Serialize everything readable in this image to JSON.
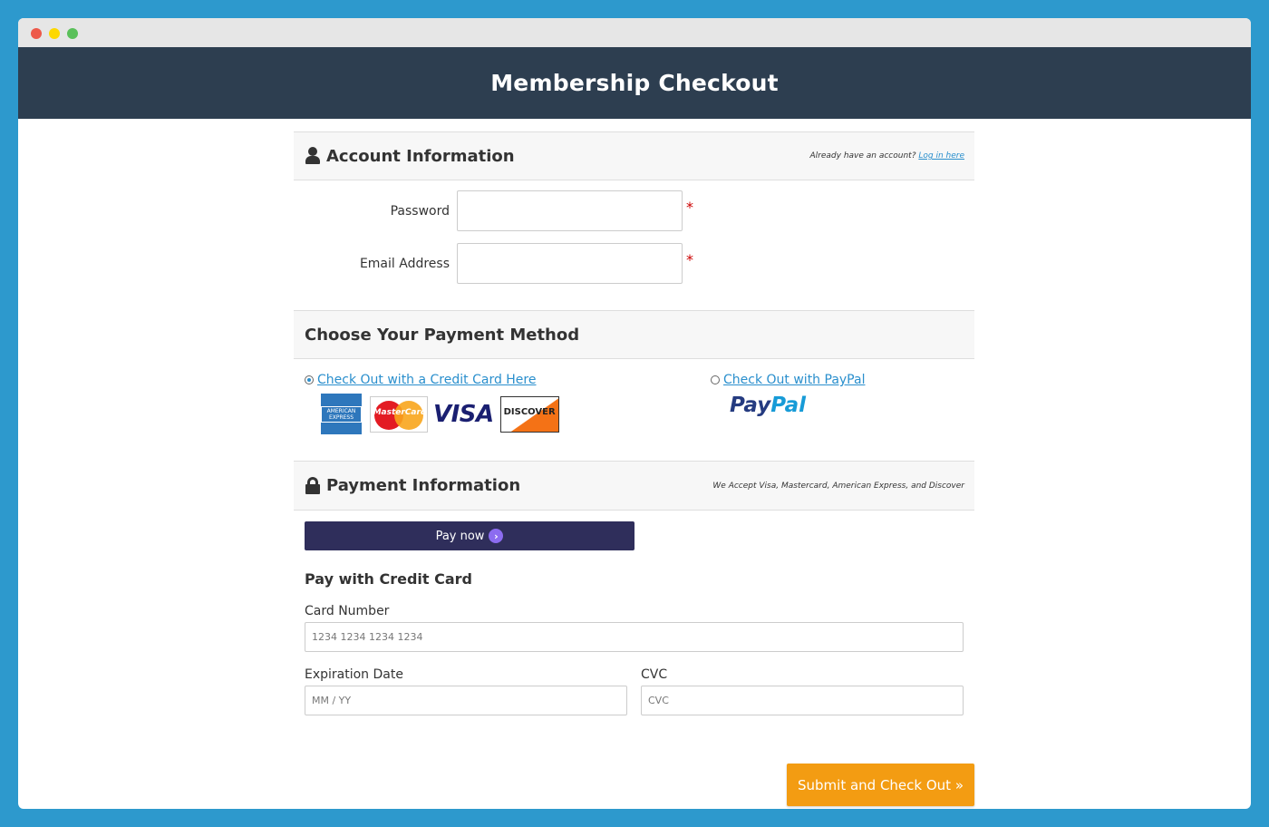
{
  "page": {
    "title": "Membership Checkout"
  },
  "account": {
    "heading": "Account Information",
    "note_prefix": "Already have an account?",
    "login_link": "Log in here",
    "fields": [
      {
        "label": "Password",
        "value": ""
      },
      {
        "label": "Email Address",
        "value": ""
      }
    ],
    "required_mark": "*"
  },
  "payment_method": {
    "heading": "Choose Your Payment Method",
    "credit_card": {
      "label": "Check Out with a Credit Card Here",
      "selected": true
    },
    "paypal": {
      "label": "Check Out with PayPal",
      "selected": false,
      "logo_pay": "Pay",
      "logo_pal": "Pal"
    },
    "cards": [
      "American Express",
      "MasterCard",
      "VISA",
      "DISCOVER"
    ],
    "card_logo_text": {
      "amex": "AMERICAN EXPRESS",
      "mastercard": "MasterCard",
      "visa": "VISA",
      "discover": "DISCOVER"
    }
  },
  "payment_info": {
    "heading": "Payment Information",
    "note": "We Accept Visa, Mastercard, American Express, and Discover",
    "pay_now_label": "Pay now",
    "pay_with_heading": "Pay with Credit Card",
    "card_number": {
      "label": "Card Number",
      "placeholder": "1234 1234 1234 1234"
    },
    "expiration": {
      "label": "Expiration Date",
      "placeholder": "MM / YY"
    },
    "cvc": {
      "label": "CVC",
      "placeholder": "CVC"
    }
  },
  "submit_label": "Submit and Check Out »",
  "colors": {
    "background": "#2d99cd",
    "banner": "#2d3e50",
    "accent": "#f39c12",
    "link": "#2a8fcd"
  }
}
